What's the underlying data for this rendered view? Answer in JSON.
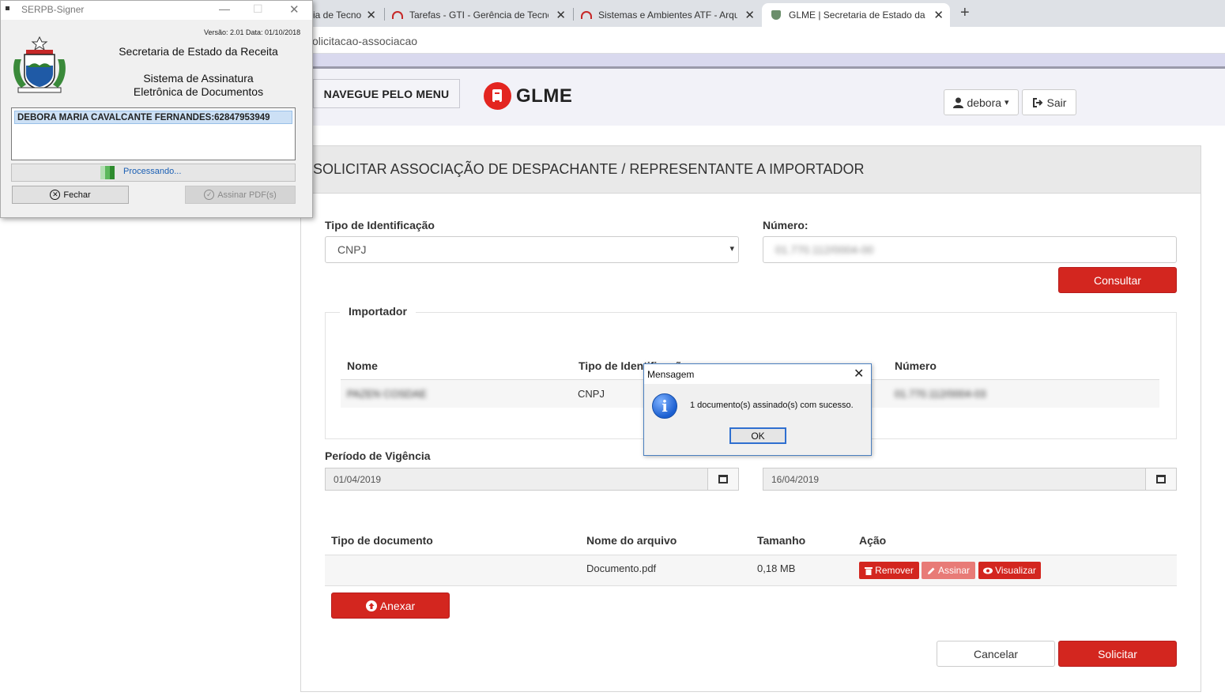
{
  "browser": {
    "tabs": [
      {
        "label": "ia de Tecno",
        "active": false
      },
      {
        "label": "Tarefas - GTI - Gerência de Tecno",
        "active": false
      },
      {
        "label": "Sistemas e Ambientes ATF - Arqu",
        "active": false
      },
      {
        "label": "GLME | Secretaria de Estado da R",
        "active": true
      }
    ],
    "close_glyph": "✕",
    "new_tab_glyph": "+",
    "address": "olicitacao-associacao"
  },
  "header": {
    "menu_button": "NAVEGUE PELO MENU",
    "logo_text": "GLME",
    "user_label": "debora",
    "user_caret": "▾",
    "logout_label": "Sair",
    "brand_color": "#e32520"
  },
  "form": {
    "title": "SOLICITAR ASSOCIAÇÃO DE DESPACHANTE / REPRESENTANTE A IMPORTADOR",
    "tipo_label": "Tipo de Identificação",
    "tipo_value": "CNPJ",
    "select_caret": "▾",
    "numero_label": "Número:",
    "numero_value": "01.770.112/0004-00",
    "consultar_button": "Consultar",
    "importador": {
      "legend": "Importador",
      "headers": {
        "nome": "Nome",
        "tipo": "Tipo de Identificação",
        "numero": "Número"
      },
      "row": {
        "nome": "PAZEN COSDAE",
        "tipo": "CNPJ",
        "numero": "01.770.112/0004-03"
      }
    },
    "vigencia": {
      "label": "Período de Vigência",
      "start": "01/04/2019",
      "end": "16/04/2019"
    },
    "documents": {
      "headers": {
        "tipo": "Tipo de documento",
        "nome": "Nome do arquivo",
        "tamanho": "Tamanho",
        "acao": "Ação"
      },
      "row": {
        "tipo": "",
        "nome": "Documento.pdf",
        "tamanho": "0,18 MB"
      },
      "actions": {
        "remover": "Remover",
        "assinar": "Assinar",
        "visualizar": "Visualizar"
      }
    },
    "anexar_button": "Anexar",
    "cancelar_button": "Cancelar",
    "solicitar_button": "Solicitar",
    "accent_red": "#d3261f"
  },
  "signer": {
    "title": "SERPB-Signer",
    "version": "Versão: 2.01 Data: 01/10/2018",
    "org": "Secretaria de Estado da Receita",
    "system_line1": "Sistema de Assinatura",
    "system_line2": "Eletrônica de Documentos",
    "certificate": "DEBORA MARIA CAVALCANTE FERNANDES:62847953949",
    "status": "Processando...",
    "fechar_button": "Fechar",
    "assinar_button": "Assinar PDF(s)",
    "min_glyph": "—",
    "max_glyph": "☐",
    "close_glyph": "✕"
  },
  "dialog": {
    "title": "Mensagem",
    "message": "1 documento(s) assinado(s) com sucesso.",
    "ok_button": "OK",
    "info_glyph": "i",
    "close_glyph": "✕"
  }
}
